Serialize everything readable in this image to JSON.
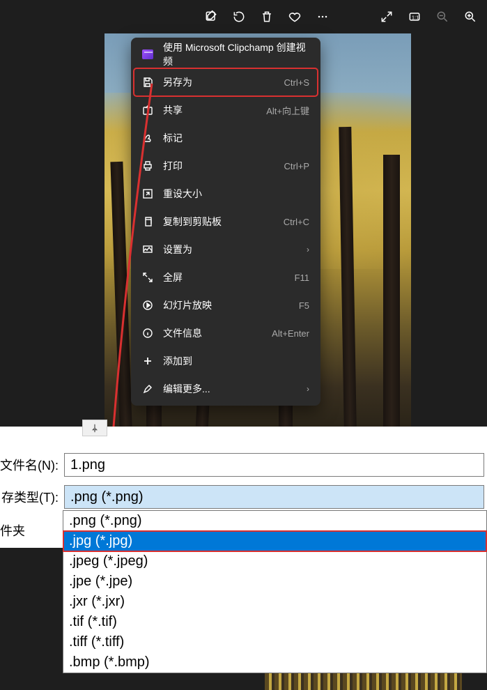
{
  "toolbar": {
    "icons": [
      "edit",
      "rotate",
      "delete",
      "favorite",
      "more",
      "fullscreen",
      "actual-size",
      "zoom-out",
      "zoom-in"
    ]
  },
  "menu": {
    "clipchamp": "使用 Microsoft Clipchamp 创建视频",
    "save_as": {
      "label": "另存为",
      "shortcut": "Ctrl+S"
    },
    "share": {
      "label": "共享",
      "shortcut": "Alt+向上键"
    },
    "markup": {
      "label": "标记"
    },
    "print": {
      "label": "打印",
      "shortcut": "Ctrl+P"
    },
    "resize": {
      "label": "重设大小"
    },
    "copy": {
      "label": "复制到剪贴板",
      "shortcut": "Ctrl+C"
    },
    "set_as": {
      "label": "设置为"
    },
    "fullscreen": {
      "label": "全屏",
      "shortcut": "F11"
    },
    "slideshow": {
      "label": "幻灯片放映",
      "shortcut": "F5"
    },
    "file_info": {
      "label": "文件信息",
      "shortcut": "Alt+Enter"
    },
    "add_to": {
      "label": "添加到"
    },
    "edit_more": {
      "label": "编辑更多..."
    }
  },
  "save_dialog": {
    "filename_label": "文件名(N):",
    "filename_value": "1.png",
    "filetype_label": "存类型(T):",
    "filetype_value": ".png (*.png)",
    "browse_folder": "件夹",
    "options": [
      ".png (*.png)",
      ".jpg (*.jpg)",
      ".jpeg (*.jpeg)",
      ".jpe (*.jpe)",
      ".jxr (*.jxr)",
      ".tif (*.tif)",
      ".tiff (*.tiff)",
      ".bmp (*.bmp)"
    ]
  }
}
